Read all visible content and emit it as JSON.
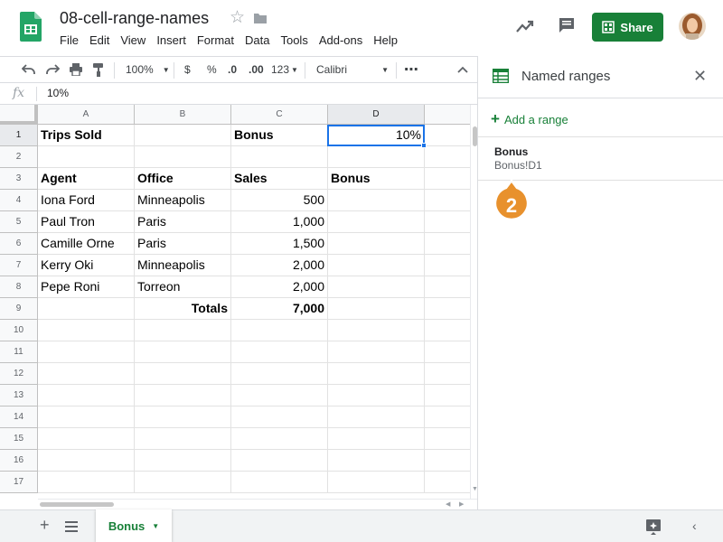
{
  "doc": {
    "title": "08-cell-range-names"
  },
  "menu": [
    "File",
    "Edit",
    "View",
    "Insert",
    "Format",
    "Data",
    "Tools",
    "Add-ons",
    "Help"
  ],
  "header": {
    "share_label": "Share"
  },
  "toolbar": {
    "zoom": "100%",
    "currency": "$",
    "percent": "%",
    "dec_decrease": ".0",
    "dec_increase": ".00",
    "more_formats": "123",
    "font": "Calibri",
    "more": "⋯"
  },
  "formula_bar": {
    "fx": "fx",
    "value": "10%"
  },
  "grid": {
    "columns": [
      "A",
      "B",
      "C",
      "D"
    ],
    "selected_column": "D",
    "selected_row": 1,
    "rows": [
      {
        "n": "1",
        "a": "Trips Sold",
        "b": "",
        "c": "Bonus",
        "d": "10%"
      },
      {
        "n": "2",
        "a": "",
        "b": "",
        "c": "",
        "d": ""
      },
      {
        "n": "3",
        "a": "Agent",
        "b": "Office",
        "c": "Sales",
        "d": "Bonus"
      },
      {
        "n": "4",
        "a": "Iona Ford",
        "b": "Minneapolis",
        "c": "500",
        "d": ""
      },
      {
        "n": "5",
        "a": "Paul Tron",
        "b": "Paris",
        "c": "1,000",
        "d": ""
      },
      {
        "n": "6",
        "a": "Camille Orne",
        "b": "Paris",
        "c": "1,500",
        "d": ""
      },
      {
        "n": "7",
        "a": "Kerry Oki",
        "b": "Minneapolis",
        "c": "2,000",
        "d": ""
      },
      {
        "n": "8",
        "a": "Pepe Roni",
        "b": "Torreon",
        "c": "2,000",
        "d": ""
      },
      {
        "n": "9",
        "a": "",
        "b": "Totals",
        "c": "7,000",
        "d": ""
      },
      {
        "n": "10",
        "a": "",
        "b": "",
        "c": "",
        "d": ""
      },
      {
        "n": "11",
        "a": "",
        "b": "",
        "c": "",
        "d": ""
      },
      {
        "n": "12",
        "a": "",
        "b": "",
        "c": "",
        "d": ""
      },
      {
        "n": "13",
        "a": "",
        "b": "",
        "c": "",
        "d": ""
      },
      {
        "n": "14",
        "a": "",
        "b": "",
        "c": "",
        "d": ""
      },
      {
        "n": "15",
        "a": "",
        "b": "",
        "c": "",
        "d": ""
      },
      {
        "n": "16",
        "a": "",
        "b": "",
        "c": "",
        "d": ""
      },
      {
        "n": "17",
        "a": "",
        "b": "",
        "c": "",
        "d": ""
      }
    ]
  },
  "sheets": {
    "active": "Bonus"
  },
  "panel": {
    "title": "Named ranges",
    "add_label": "Add a range",
    "ranges": [
      {
        "name": "Bonus",
        "ref": "Bonus!D1"
      }
    ],
    "step_badge": "2"
  },
  "colors": {
    "accent": "#188038",
    "selection": "#1a73e8",
    "badge": "#e8912d"
  }
}
